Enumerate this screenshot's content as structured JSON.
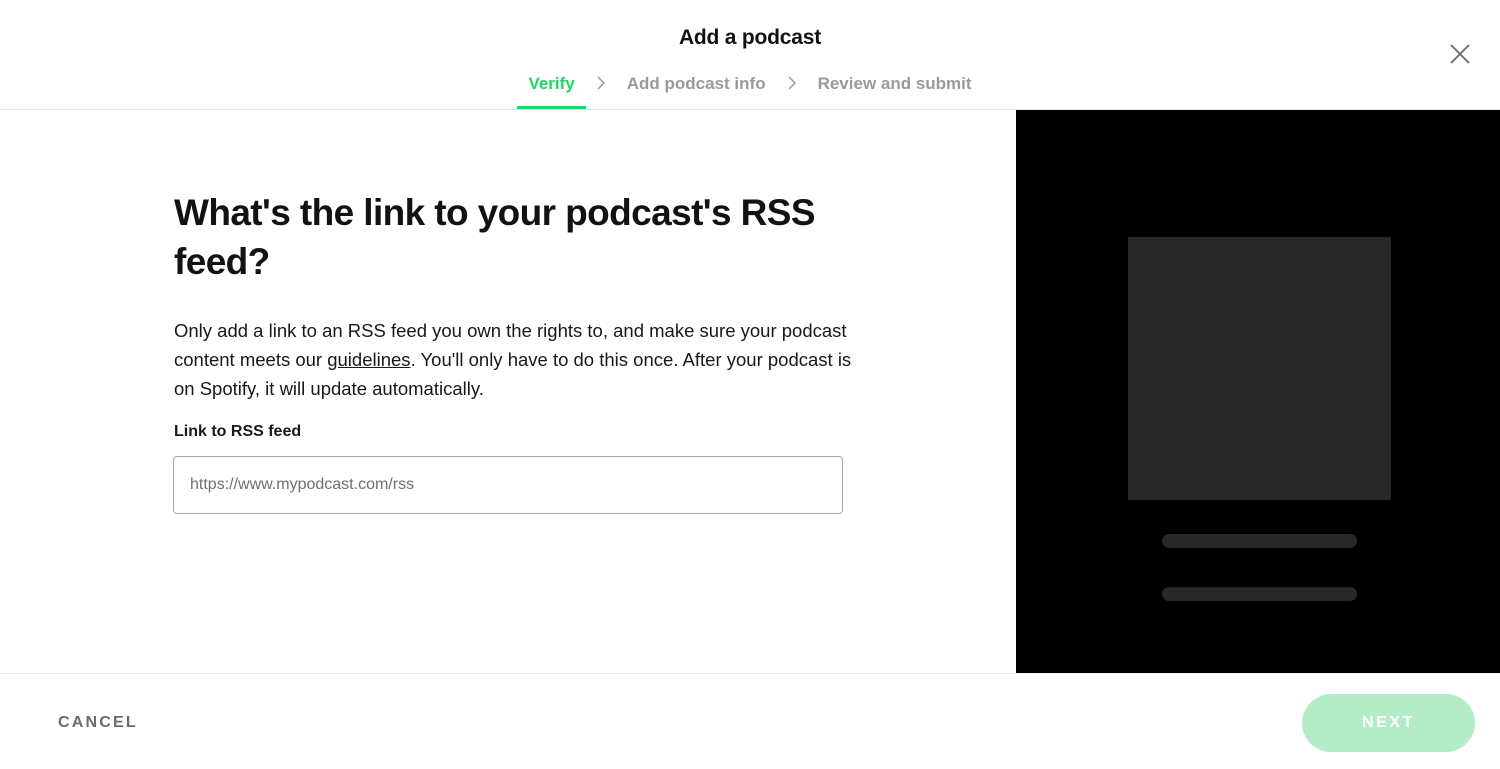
{
  "dialog": {
    "title": "Add a podcast",
    "close_icon": "close-icon"
  },
  "stepper": {
    "steps": [
      {
        "label": "Verify",
        "state": "active"
      },
      {
        "label": "Add podcast info",
        "state": "inactive"
      },
      {
        "label": "Review and submit",
        "state": "inactive"
      }
    ],
    "separator_icon": "chevron-right-icon",
    "active_color": "#1ed760"
  },
  "main": {
    "heading": "What's the link to your podcast's RSS feed?",
    "description_before_link": "Only add a link to an RSS feed you own the rights to, and make sure your podcast content meets our ",
    "description_link": "guidelines",
    "description_after_link": ". You'll only have to do this once. After your podcast is on Spotify, it will update automatically.",
    "field_label": "Link to RSS feed",
    "rss_input": {
      "value": "",
      "placeholder": "https://www.mypodcast.com/rss"
    }
  },
  "preview": {
    "background": "#000000",
    "placeholder_color": "#282828"
  },
  "footer": {
    "cancel_label": "CANCEL",
    "next_label": "NEXT",
    "next_color": "#b4ecc8"
  }
}
